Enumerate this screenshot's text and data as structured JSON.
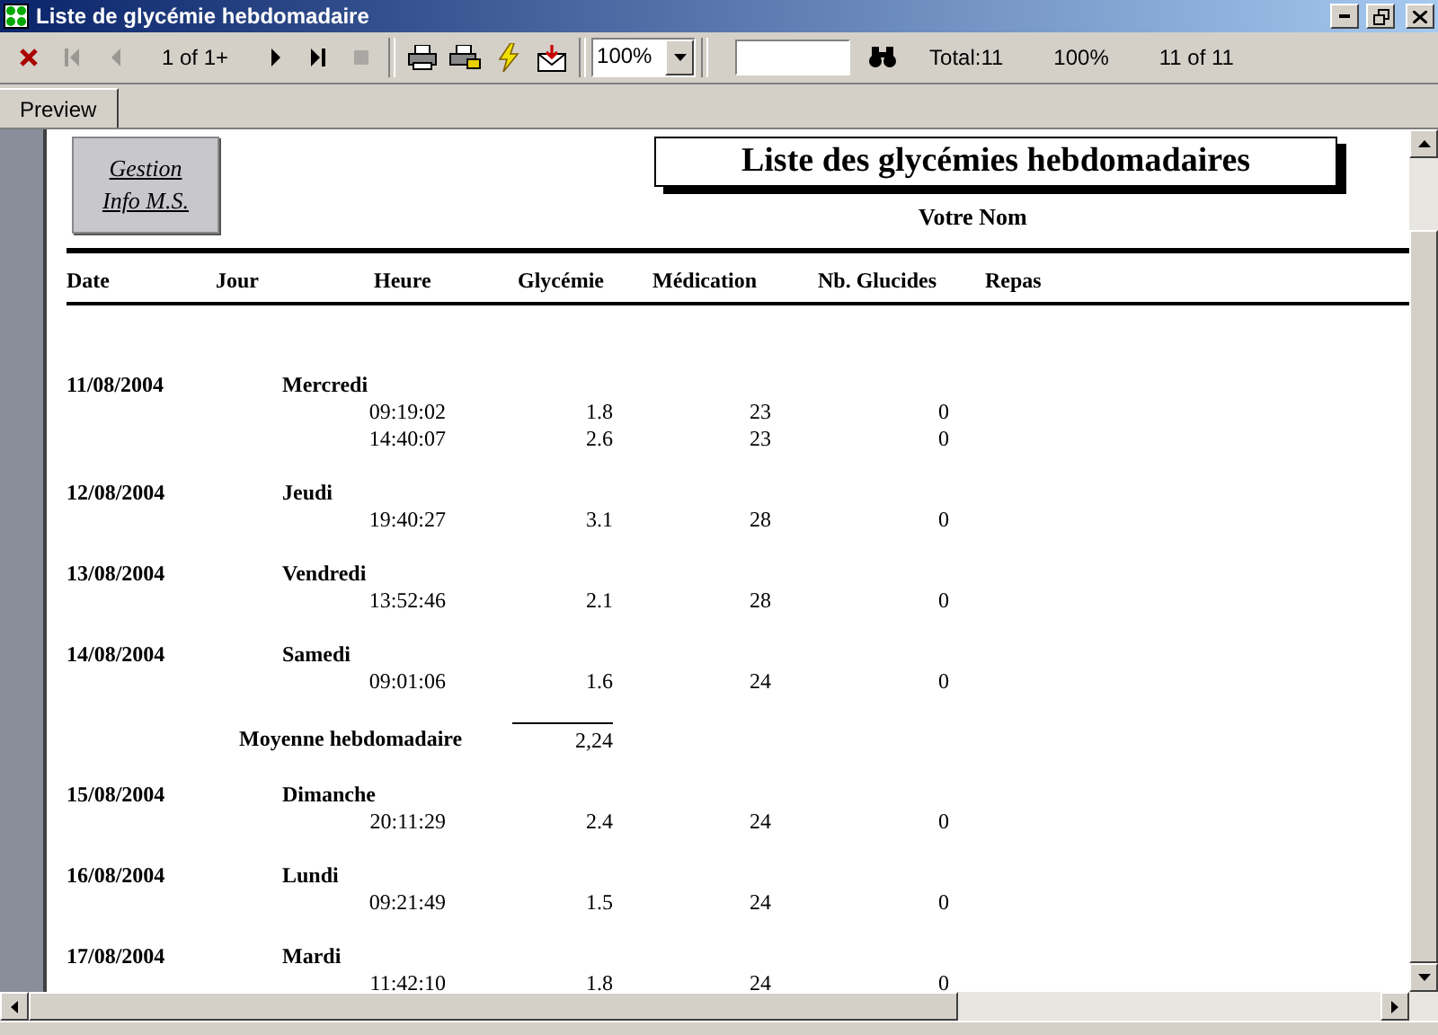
{
  "window": {
    "title": "Liste de glycémie hebdomadaire"
  },
  "toolbar": {
    "items": [
      {
        "kind": "close",
        "disabled": false
      },
      {
        "kind": "first",
        "disabled": true
      },
      {
        "kind": "prev",
        "disabled": true
      },
      {
        "kind": "text",
        "label": "1 of 1+"
      },
      {
        "kind": "next",
        "disabled": false
      },
      {
        "kind": "last",
        "disabled": false
      },
      {
        "kind": "stop",
        "disabled": true
      },
      {
        "kind": "sep"
      },
      {
        "kind": "print",
        "disabled": false
      },
      {
        "kind": "printsetup",
        "disabled": false
      },
      {
        "kind": "refresh",
        "disabled": false
      },
      {
        "kind": "export",
        "disabled": false
      },
      {
        "kind": "sep"
      },
      {
        "kind": "zoom",
        "value": "100%"
      },
      {
        "kind": "sep"
      },
      {
        "kind": "search"
      },
      {
        "kind": "find",
        "disabled": false
      },
      {
        "kind": "text",
        "label": "Total:11"
      },
      {
        "kind": "text",
        "label": "100%"
      },
      {
        "kind": "text",
        "label": "11 of 11"
      }
    ]
  },
  "tabs": [
    {
      "label": "Preview",
      "selected": true
    }
  ],
  "report": {
    "logo": [
      "Gestion",
      "Info M.S."
    ],
    "title": "Liste des glycémies hebdomadaires",
    "subtitle": "Votre Nom",
    "columns": [
      "Date",
      "Jour",
      "Heure",
      "Glycémie",
      "Médication",
      "Nb. Glucides",
      "Repas"
    ],
    "groups": [
      {
        "kind": "day",
        "date": "11/08/2004",
        "day": "Mercredi",
        "rows": [
          [
            "09:19:02",
            "1.8",
            "23",
            "0"
          ],
          [
            "14:40:07",
            "2.6",
            "23",
            "0"
          ]
        ]
      },
      {
        "kind": "day",
        "date": "12/08/2004",
        "day": "Jeudi",
        "rows": [
          [
            "19:40:27",
            "3.1",
            "28",
            "0"
          ]
        ]
      },
      {
        "kind": "day",
        "date": "13/08/2004",
        "day": "Vendredi",
        "rows": [
          [
            "13:52:46",
            "2.1",
            "28",
            "0"
          ]
        ]
      },
      {
        "kind": "day",
        "date": "14/08/2004",
        "day": "Samedi",
        "rows": [
          [
            "09:01:06",
            "1.6",
            "24",
            "0"
          ]
        ]
      },
      {
        "kind": "average",
        "label": "Moyenne hebdomadaire",
        "value": "2,24"
      },
      {
        "kind": "day",
        "date": "15/08/2004",
        "day": "Dimanche",
        "rows": [
          [
            "20:11:29",
            "2.4",
            "24",
            "0"
          ]
        ]
      },
      {
        "kind": "day",
        "date": "16/08/2004",
        "day": "Lundi",
        "rows": [
          [
            "09:21:49",
            "1.5",
            "24",
            "0"
          ]
        ]
      },
      {
        "kind": "day",
        "date": "17/08/2004",
        "day": "Mardi",
        "rows": [
          [
            "11:42:10",
            "1.8",
            "24",
            "0"
          ]
        ]
      }
    ]
  }
}
